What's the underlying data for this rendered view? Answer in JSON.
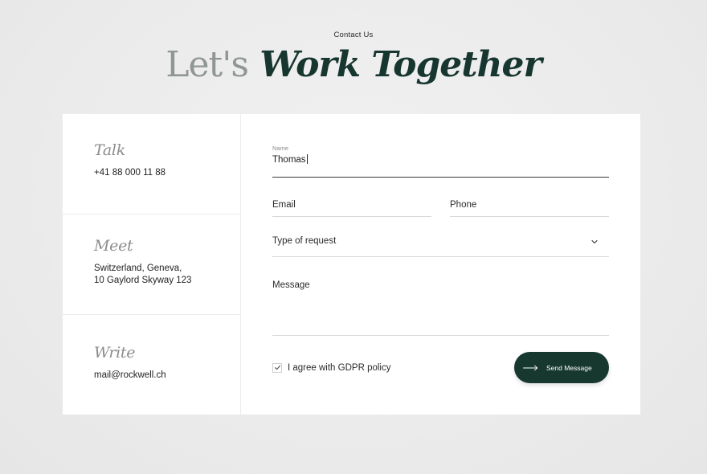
{
  "header": {
    "eyebrow": "Contact Us",
    "title_light": "Let's",
    "title_dark": "Work Together"
  },
  "contact": {
    "talk": {
      "title": "Talk",
      "value": "+41 88 000 11 88"
    },
    "meet": {
      "title": "Meet",
      "line1": "Switzerland, Geneva,",
      "line2": "10 Gaylord Skyway 123"
    },
    "write": {
      "title": "Write",
      "value": "mail@rockwell.ch"
    }
  },
  "form": {
    "name_label": "Name",
    "name_value": "Thomas",
    "email_placeholder": "Email",
    "phone_placeholder": "Phone",
    "request_placeholder": "Type of request",
    "message_placeholder": "Message",
    "gdpr_label": "I agree with GDPR policy",
    "gdpr_checked": true,
    "send_label": "Send Message"
  },
  "colors": {
    "brand_dark": "#17382f",
    "title_light": "#8f9693",
    "background": "#ebebeb"
  },
  "icons": {
    "chevron": "chevron-down-icon",
    "check": "check-icon",
    "arrow": "arrow-right-icon"
  }
}
